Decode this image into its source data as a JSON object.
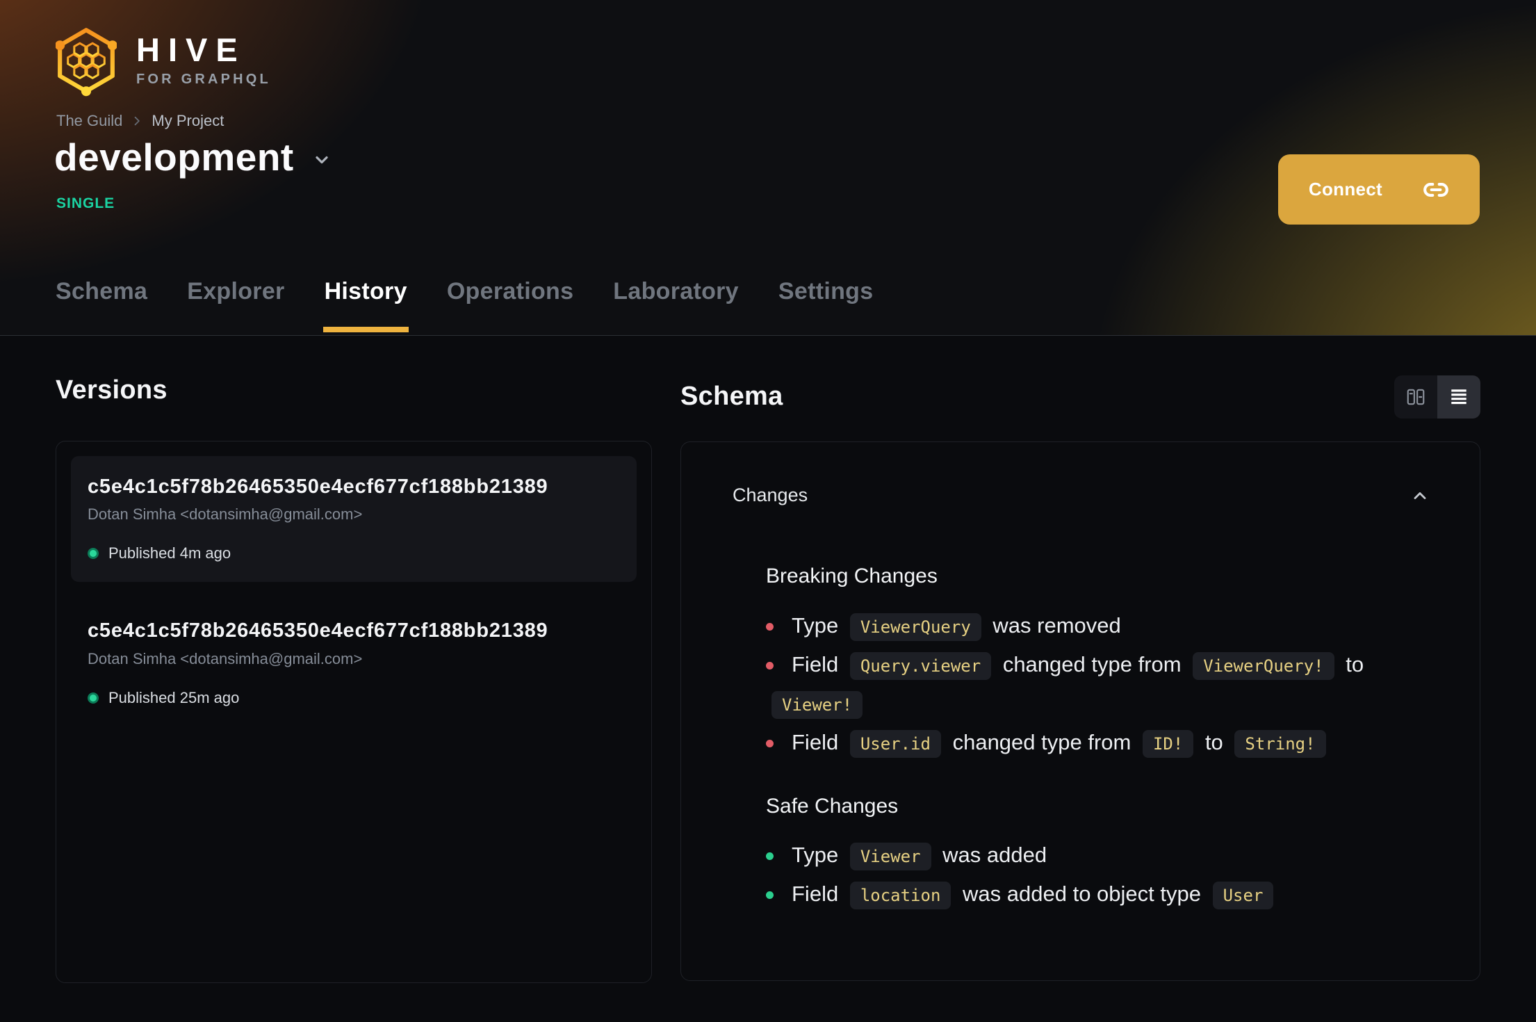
{
  "brand": {
    "name": "HIVE",
    "tagline": "FOR GRAPHQL"
  },
  "breadcrumb": {
    "items": [
      "The Guild",
      "My Project"
    ]
  },
  "project": {
    "name": "development",
    "badge": "SINGLE"
  },
  "header": {
    "connect_label": "Connect"
  },
  "tabs": [
    {
      "label": "Schema",
      "active": false
    },
    {
      "label": "Explorer",
      "active": false
    },
    {
      "label": "History",
      "active": true
    },
    {
      "label": "Operations",
      "active": false
    },
    {
      "label": "Laboratory",
      "active": false
    },
    {
      "label": "Settings",
      "active": false
    }
  ],
  "versions": {
    "title": "Versions",
    "items": [
      {
        "hash": "c5e4c1c5f78b26465350e4ecf677cf188bb21389",
        "author": "Dotan Simha <dotansimha@gmail.com>",
        "status": "Published 4m ago",
        "selected": true
      },
      {
        "hash": "c5e4c1c5f78b26465350e4ecf677cf188bb21389",
        "author": "Dotan Simha <dotansimha@gmail.com>",
        "status": "Published 25m ago",
        "selected": false
      }
    ]
  },
  "schema": {
    "title": "Schema",
    "changes": {
      "label": "Changes",
      "collapse_icon": "chevron-up-icon",
      "sections": [
        {
          "kind": "breaking",
          "title": "Breaking Changes",
          "items": [
            [
              {
                "text": "Type "
              },
              {
                "code": "ViewerQuery"
              },
              {
                "text": " was removed"
              }
            ],
            [
              {
                "text": "Field "
              },
              {
                "code": "Query.viewer"
              },
              {
                "text": " changed type from "
              },
              {
                "code": "ViewerQuery!"
              },
              {
                "text": " to "
              },
              {
                "code": "Viewer!"
              }
            ],
            [
              {
                "text": "Field "
              },
              {
                "code": "User.id"
              },
              {
                "text": " changed type from "
              },
              {
                "code": "ID!"
              },
              {
                "text": " to "
              },
              {
                "code": "String!"
              }
            ]
          ]
        },
        {
          "kind": "safe",
          "title": "Safe Changes",
          "items": [
            [
              {
                "text": "Type "
              },
              {
                "code": "Viewer"
              },
              {
                "text": " was added"
              }
            ],
            [
              {
                "text": "Field "
              },
              {
                "code": "location"
              },
              {
                "text": " was added to object type "
              },
              {
                "code": "User"
              }
            ]
          ]
        }
      ]
    }
  },
  "icons": {
    "logo": "hive-hexagon-logo",
    "breadcrumb_separator": "chevron-right-icon",
    "target_selector": "chevron-down-icon",
    "connect": "link-icon",
    "view_split": "columns-icon",
    "view_list": "list-icon",
    "published": "green-dot-icon"
  },
  "colors": {
    "accent": "#eeb33f",
    "connect_button": "#dba63e",
    "badge": "#1bd3a2",
    "breaking_bullet": "#e25c66",
    "safe_bullet": "#2bcf8e",
    "code_text": "#e7d183"
  }
}
